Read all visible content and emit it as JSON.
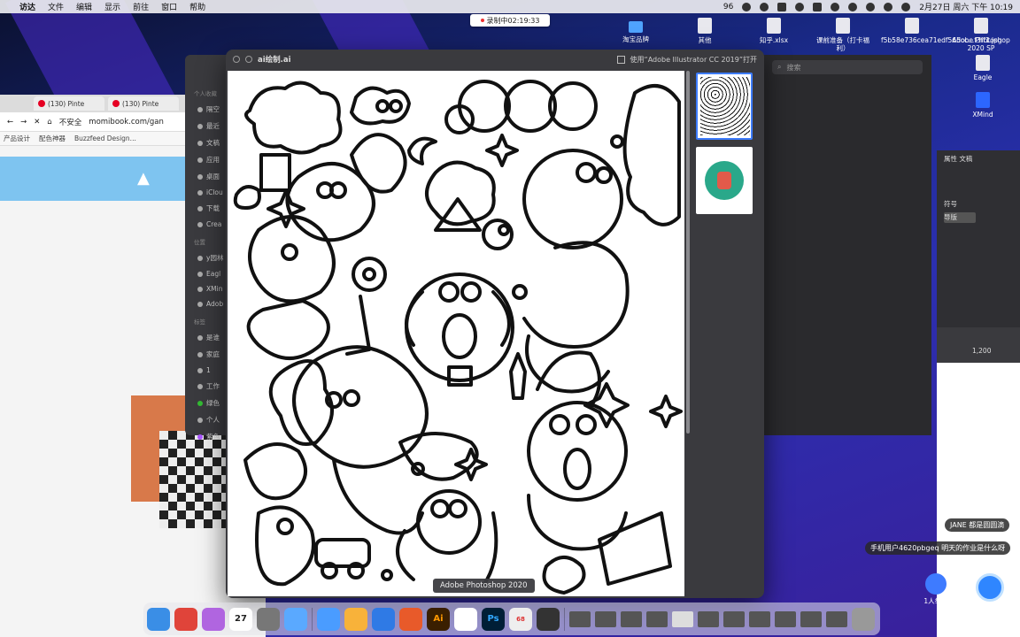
{
  "menubar": {
    "app": "访达",
    "items": [
      "文件",
      "编辑",
      "显示",
      "前往",
      "窗口",
      "帮助"
    ],
    "badge_count": "96",
    "datetime": "2月27日 周六 下午 10:19"
  },
  "recording": {
    "label": "录制中02:19:33"
  },
  "desktop_icons": [
    {
      "label": "淘宝品牌"
    },
    {
      "label": "其他"
    },
    {
      "label": "知乎.xlsx"
    },
    {
      "label": "课前准备（打卡福利）"
    },
    {
      "label": "f5b58e736cea71edf565cc...f3ff1.jpg"
    },
    {
      "label": "Adobe Photoshop 2020 SP"
    },
    {
      "label": "Eagle"
    },
    {
      "label": "XMind"
    }
  ],
  "browser": {
    "tabs": [
      "(130) Pinte",
      "(130) Pinte"
    ],
    "security": "不安全",
    "url": "momibook.com/gan",
    "bookmarks": [
      "产品设计",
      "配色神器",
      "Buzzfeed Design..."
    ]
  },
  "finder": {
    "sections": {
      "personal": "个人收藏",
      "locations": "位置",
      "tags": "标签"
    },
    "favorites": [
      "隔空",
      "最近",
      "文稿",
      "应用",
      "桌面",
      "iClou",
      "下载",
      "Crea"
    ],
    "locations": [
      "y园林",
      "Eagl",
      "XMin",
      "Adob"
    ],
    "tags": [
      "是谁",
      "家庭",
      "1",
      "工作",
      "绿色",
      "个人",
      "紫色"
    ]
  },
  "darkwin": {
    "search_placeholder": "搜索"
  },
  "panel": {
    "tab_a": "属性",
    "tab_b": "文稿",
    "label1": "符号",
    "label2": "导版"
  },
  "ruler": {
    "value": "1,200"
  },
  "quicklook": {
    "title": "ai绘制.ai",
    "open_with": "使用“Adobe Illustrator CC 2019”打开"
  },
  "tooltip": "Adobe Photoshop 2020",
  "dock": {
    "calendar_day": "27",
    "badge": "68",
    "ai_label": "Ai",
    "ps_label": "Ps"
  },
  "stream": {
    "comments": [
      {
        "user": "JANE",
        "text": "都是圆圆滴"
      },
      {
        "user": "手机用户4620pbgeq",
        "text": "明天的作业是什么呀"
      }
    ],
    "raise_hand": "1人举手"
  }
}
